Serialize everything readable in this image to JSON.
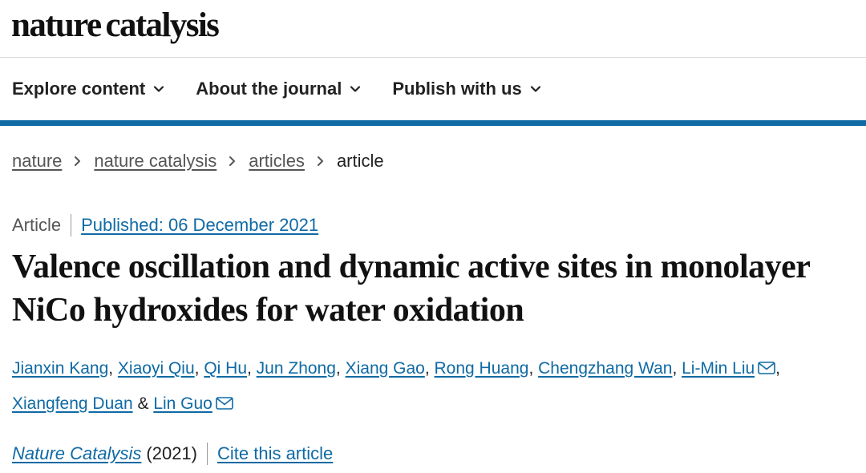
{
  "brand": {
    "word1": "nature",
    "word2": "catalysis"
  },
  "nav": {
    "items": [
      {
        "label": "Explore content",
        "icon": "chevron-down-icon"
      },
      {
        "label": "About the journal",
        "icon": "chevron-down-icon"
      },
      {
        "label": "Publish with us",
        "icon": "chevron-down-icon"
      }
    ]
  },
  "breadcrumb": {
    "items": [
      "nature",
      "nature catalysis",
      "articles"
    ],
    "current": "article"
  },
  "article": {
    "type": "Article",
    "published": "Published: 06 December 2021",
    "title": "Valence oscillation and dynamic active sites in monolayer NiCo hydroxides for water oxidation",
    "authors": [
      {
        "name": "Jianxin Kang",
        "after": ", "
      },
      {
        "name": "Xiaoyi Qiu",
        "after": ", "
      },
      {
        "name": "Qi Hu",
        "after": ", "
      },
      {
        "name": "Jun Zhong",
        "after": ", "
      },
      {
        "name": "Xiang Gao",
        "after": ", "
      },
      {
        "name": "Rong Huang",
        "after": ", "
      },
      {
        "name": "Chengzhang Wan",
        "after": ", "
      },
      {
        "name": "Li-Min Liu",
        "after": ", "
      },
      {
        "name": "Xiangfeng Duan",
        "after": " & "
      },
      {
        "name": "Lin Guo",
        "after": ""
      }
    ],
    "journal": "Nature Catalysis",
    "year": "(2021)",
    "cite_label": "Cite this article"
  },
  "colors": {
    "accent": "#0f6aa5",
    "text": "#222222",
    "muted": "#555555"
  }
}
